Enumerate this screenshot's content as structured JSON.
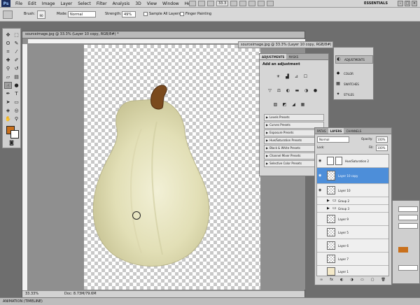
{
  "app": {
    "logo": "Ps",
    "menu": [
      "File",
      "Edit",
      "Image",
      "Layer",
      "Select",
      "Filter",
      "Analysis",
      "3D",
      "View",
      "Window",
      "Help"
    ],
    "zoom_combo": "33.3",
    "workspace": "ESSENTIALS",
    "window_controls": [
      "–",
      "□",
      "×"
    ]
  },
  "options_bar": {
    "brush_label": "Brush:",
    "brush_size": "90",
    "mode_label": "Mode:",
    "mode_value": "Normal",
    "strength_label": "Strength:",
    "strength_value": "49%",
    "sample_all_layers": "Sample All Layers",
    "finger_painting": "Finger Painting"
  },
  "document": {
    "title": "sourceimage.jpg @ 33.3% (Layer 10 copy, RGB/8#) *",
    "secondary_title": "sourceimage.jpg @ 33.3% (Layer 10 copy, RGB/8#) *",
    "zoom_status": "33.33%",
    "doc_status": "Doc: 8.73M/79.6M"
  },
  "adjustments": {
    "tabs": [
      "ADJUSTMENTS",
      "MASKS"
    ],
    "heading": "Add an adjustment",
    "icon_rows": [
      [
        "☀",
        "▟",
        "⊿",
        "☐"
      ],
      [
        "▽",
        "⚖",
        "◐",
        "▬",
        "◑",
        "●"
      ],
      [
        "▨",
        "◩",
        "◢",
        "▦"
      ]
    ],
    "presets": [
      "Levels Presets",
      "Curves Presets",
      "Exposure Presets",
      "Hue/Saturation Presets",
      "Black & White Presets",
      "Channel Mixer Presets",
      "Selective Color Presets"
    ]
  },
  "dock": {
    "items": [
      {
        "label": "ADJUSTMENTS",
        "icon": "◐"
      },
      {
        "label": "COLOR",
        "icon": "◆"
      },
      {
        "label": "SWATCHES",
        "icon": "▦"
      },
      {
        "label": "STYLES",
        "icon": "✦"
      }
    ]
  },
  "layers": {
    "tabs": [
      "PATHS",
      "LAYERS",
      "CHANNELS"
    ],
    "blend_mode": "Normal",
    "opacity_label": "Opacity:",
    "opacity_value": "100%",
    "lock_label": "Lock:",
    "fill_label": "Fill:",
    "fill_value": "100%",
    "rows": [
      {
        "name": "Hue/Saturation 2",
        "type": "adjustment",
        "selected": false
      },
      {
        "name": "Layer 10 copy",
        "type": "layer",
        "selected": true
      },
      {
        "name": "Layer 10",
        "type": "layer",
        "selected": false
      },
      {
        "name": "Group 2",
        "type": "group",
        "selected": false
      },
      {
        "name": "Group 3",
        "type": "group",
        "selected": false
      },
      {
        "name": "Layer 9",
        "type": "layer",
        "selected": false
      },
      {
        "name": "Layer 5",
        "type": "layer",
        "selected": false
      },
      {
        "name": "Layer 6",
        "type": "layer",
        "selected": false
      },
      {
        "name": "Layer 7",
        "type": "layer",
        "selected": false
      },
      {
        "name": "Layer 1",
        "type": "layer",
        "selected": false
      }
    ],
    "footer_icons": [
      "∞",
      "fx",
      "◐",
      "◑",
      "▭",
      "▢",
      "🗑"
    ]
  },
  "timeline": {
    "label": "ANIMATION (TIMELINE)"
  },
  "colors": {
    "foreground": "#c9701c",
    "background": "#ffffff",
    "selection": "#4d8ed9",
    "pear_body": "#e4e2bd",
    "pear_stem": "#7a4a1e"
  }
}
